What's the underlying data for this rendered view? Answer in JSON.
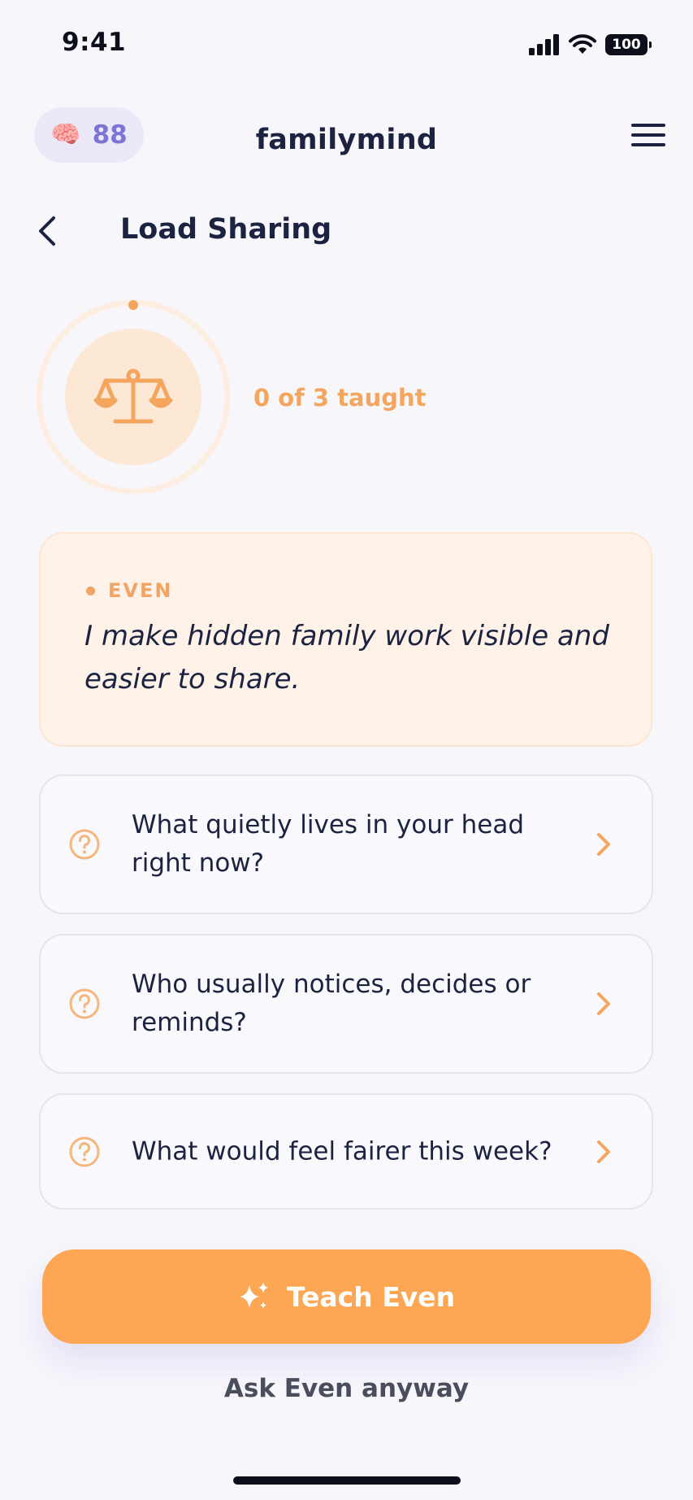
{
  "status_bar": {
    "time": "9:41",
    "battery": "100",
    "icons": [
      "cellular-signal-icon",
      "wifi-icon",
      "battery-icon"
    ]
  },
  "header": {
    "score_icon": "brain-icon",
    "score": "88",
    "app_title": "familymind",
    "menu_icon": "hamburger-menu-icon"
  },
  "page": {
    "back_icon": "chevron-left-icon",
    "title": "Load Sharing"
  },
  "progress": {
    "icon": "balance-scale-icon",
    "text": "0 of 3 taught",
    "taught": 0,
    "total": 3
  },
  "even_card": {
    "label": "EVEN",
    "quote": "I make hidden family work visible and easier to share."
  },
  "questions": [
    {
      "text": "What quietly lives in your head right now?",
      "icon": "question-circle-icon"
    },
    {
      "text": "Who usually notices, decides or reminds?",
      "icon": "question-circle-icon"
    },
    {
      "text": "What would feel fairer this week?",
      "icon": "question-circle-icon"
    }
  ],
  "actions": {
    "teach_label": "Teach Even",
    "teach_icon": "sparkles-icon",
    "ask_label": "Ask Even anyway"
  },
  "colors": {
    "accent_orange": "#fda653",
    "score_purple": "#7c74d6",
    "text_dark": "#1c2340",
    "card_peach": "#fff3e9"
  }
}
